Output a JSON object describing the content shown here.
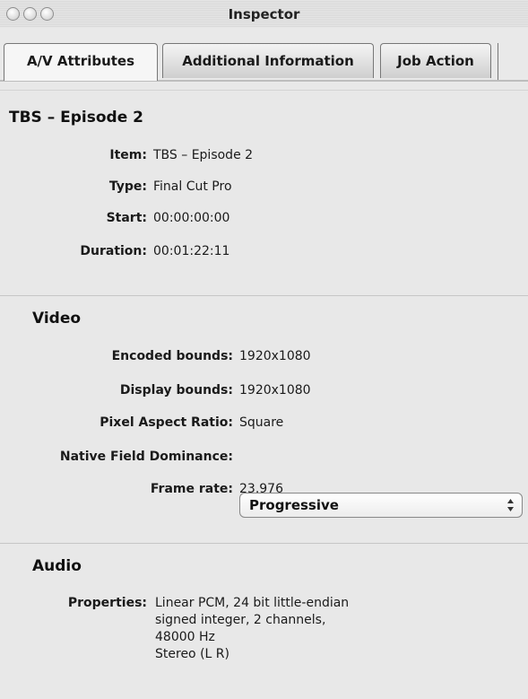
{
  "window": {
    "title": "Inspector"
  },
  "tabs": [
    {
      "label": "A/V Attributes",
      "active": true
    },
    {
      "label": "Additional Information",
      "active": false
    },
    {
      "label": "Job Action",
      "active": false
    }
  ],
  "summary": {
    "heading": "TBS – Episode 2",
    "rows": [
      {
        "label": "Item:",
        "value": "TBS – Episode 2"
      },
      {
        "label": "Type:",
        "value": "Final Cut Pro"
      },
      {
        "label": "Start:",
        "value": "00:00:00:00"
      },
      {
        "label": "Duration:",
        "value": "00:01:22:11"
      }
    ]
  },
  "video": {
    "heading": "Video",
    "encoded_bounds": {
      "label": "Encoded bounds:",
      "value": "1920x1080"
    },
    "display_bounds": {
      "label": "Display bounds:",
      "value": "1920x1080"
    },
    "pixel_aspect": {
      "label": "Pixel Aspect Ratio:",
      "value": "Square"
    },
    "field_dominance": {
      "label": "Native Field Dominance:",
      "value": "Progressive"
    },
    "frame_rate": {
      "label": "Frame rate:",
      "value": "23.976"
    }
  },
  "audio": {
    "heading": "Audio",
    "properties_label": "Properties:",
    "properties_lines": [
      "Linear PCM, 24 bit little-endian",
      "signed integer, 2 channels,",
      "48000 Hz",
      "Stereo (L R)"
    ]
  }
}
